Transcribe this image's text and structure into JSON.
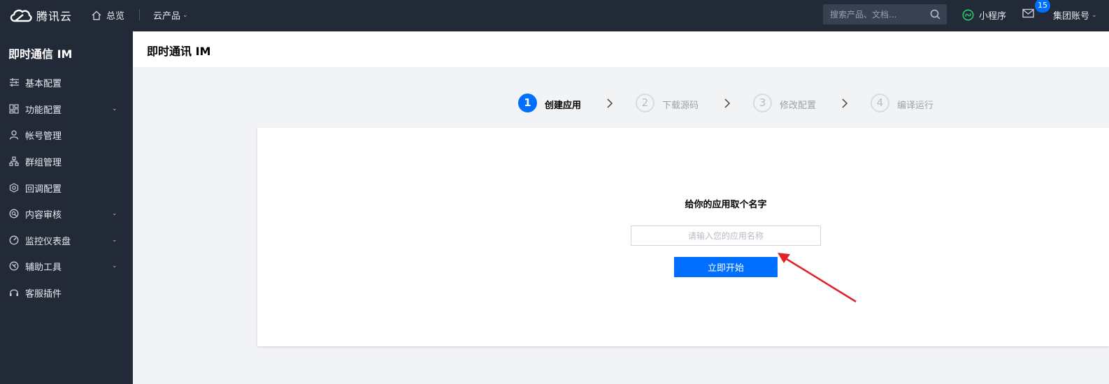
{
  "topbar": {
    "brand": "腾讯云",
    "overview": "总览",
    "products": "云产品",
    "search_placeholder": "搜索产品、文档...",
    "miniapp": "小程序",
    "mail_badge": "15",
    "account": "集团账号"
  },
  "sidebar": {
    "title": "即时通信 IM",
    "items": [
      {
        "label": "基本配置",
        "icon": "sliders-icon",
        "expandable": false
      },
      {
        "label": "功能配置",
        "icon": "grid-icon",
        "expandable": true
      },
      {
        "label": "帐号管理",
        "icon": "user-icon",
        "expandable": false
      },
      {
        "label": "群组管理",
        "icon": "group-tree-icon",
        "expandable": false
      },
      {
        "label": "回调配置",
        "icon": "callback-icon",
        "expandable": false
      },
      {
        "label": "内容审核",
        "icon": "review-icon",
        "expandable": true
      },
      {
        "label": "监控仪表盘",
        "icon": "dashboard-icon",
        "expandable": true
      },
      {
        "label": "辅助工具",
        "icon": "tools-icon",
        "expandable": true
      },
      {
        "label": "客服插件",
        "icon": "headset-icon",
        "expandable": false
      }
    ]
  },
  "main": {
    "title": "即时通讯 IM",
    "steps": [
      {
        "number": "1",
        "label": "创建应用",
        "active": true
      },
      {
        "number": "2",
        "label": "下载源码",
        "active": false
      },
      {
        "number": "3",
        "label": "修改配置",
        "active": false
      },
      {
        "number": "4",
        "label": "编译运行",
        "active": false
      }
    ],
    "card": {
      "heading": "给你的应用取个名字",
      "input_placeholder": "请输入您的应用名称",
      "input_value": "",
      "button_label": "立即开始"
    }
  },
  "colors": {
    "topbar_bg": "#232a37",
    "accent": "#006eff",
    "annotation_arrow": "#e0232b"
  }
}
